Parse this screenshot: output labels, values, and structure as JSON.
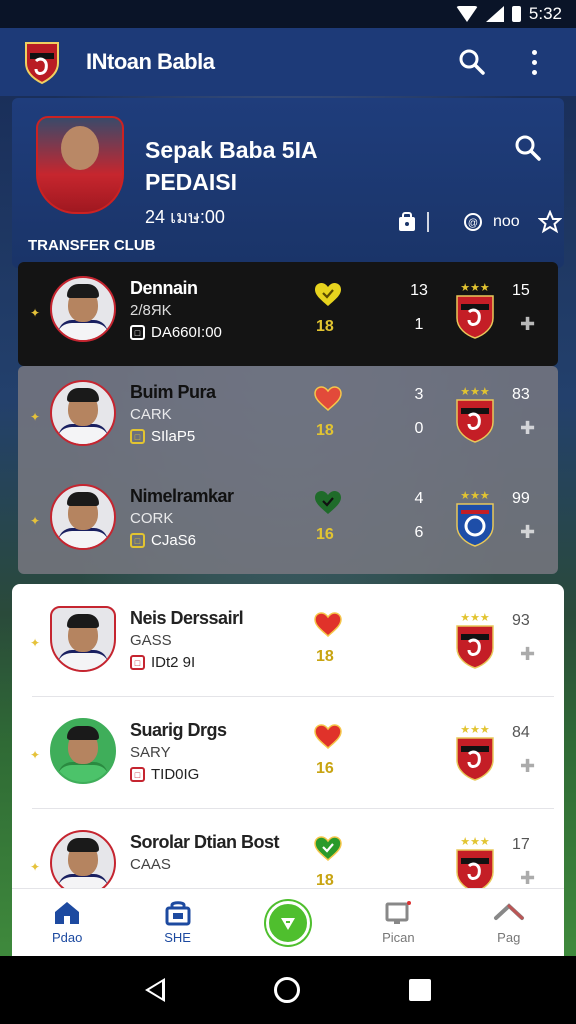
{
  "status_bar": {
    "time": "5:32"
  },
  "app_bar": {
    "title": "INtoan Babla"
  },
  "hero": {
    "title_line1": "Sepak Baba 5IA",
    "title_line2": "PEDAISI",
    "subtitle": "24 เมษ:00",
    "action_label": "noo"
  },
  "section_label": "TRANSFER CLUB",
  "players": [
    {
      "name": "Dennain",
      "position": "2/8ЯK",
      "meta": "DA660I:00",
      "rating": "18",
      "stat1": "13",
      "stat2": "1",
      "points": "15",
      "heart_color": "#e7d31e"
    },
    {
      "name": "Buim Pura",
      "position": "CARK",
      "meta": "SIlaP5",
      "rating": "18",
      "stat1": "3",
      "stat2": "0",
      "points": "83",
      "heart_color": "#e24a3a"
    },
    {
      "name": "Nimelramkar",
      "position": "CORK",
      "meta": "CJaS6",
      "rating": "16",
      "stat1": "4",
      "stat2": "6",
      "points": "99",
      "heart_color": "#1f6b2a"
    },
    {
      "name": "Neis Derssairl",
      "position": "GASS",
      "meta": "IDt2 9I",
      "rating": "18",
      "points": "93",
      "heart_color": "#e0322a"
    },
    {
      "name": "Suarig Drgs",
      "position": "SARY",
      "meta": "TID0IG",
      "rating": "16",
      "points": "84",
      "heart_color": "#e0322a"
    },
    {
      "name": "Sorolar Dtian Bost",
      "position": "CAAS",
      "meta": "",
      "rating": "18",
      "points": "17",
      "heart_color": "#2a9a2a"
    }
  ],
  "bottom_nav": [
    {
      "label": "Pdao",
      "icon": "home-icon"
    },
    {
      "label": "SHE",
      "icon": "shop-icon"
    },
    {
      "label": "",
      "icon": "whistle-icon"
    },
    {
      "label": "Pican",
      "icon": "screen-icon"
    },
    {
      "label": "Pag",
      "icon": "chevron-up-icon"
    }
  ],
  "colors": {
    "primary": "#1d3a78",
    "accent_red": "#c52530",
    "gold": "#e2c431",
    "fab_green": "#4fbf2e"
  }
}
